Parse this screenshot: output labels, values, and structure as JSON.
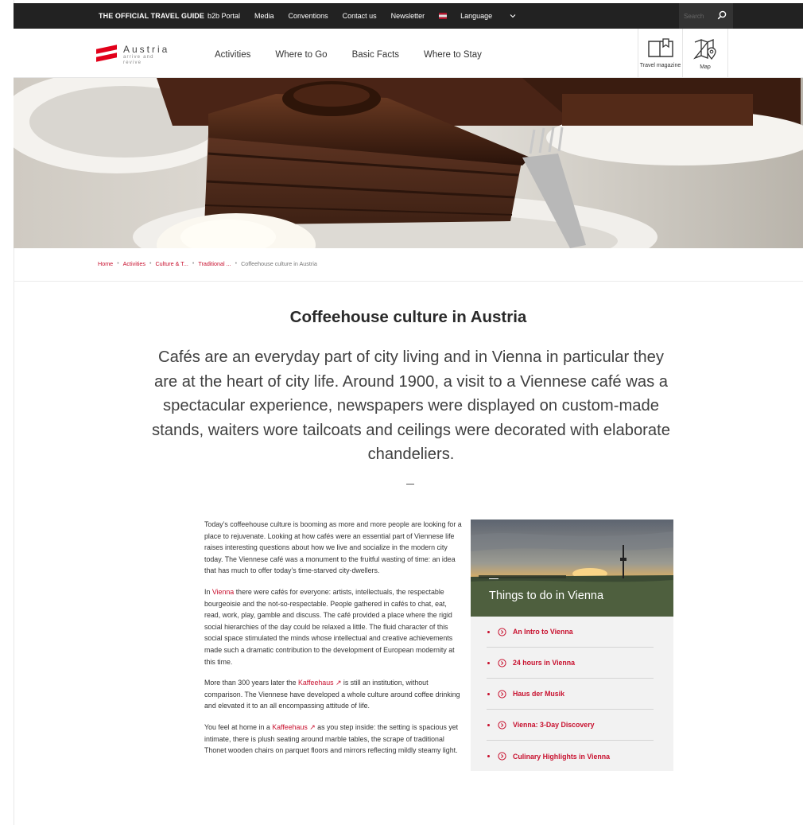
{
  "topbar": {
    "official": "THE OFFICIAL TRAVEL GUIDE",
    "links": [
      "b2b Portal",
      "Media",
      "Conventions",
      "Contact us",
      "Newsletter"
    ],
    "language": "Language",
    "search_placeholder": "Search"
  },
  "header": {
    "logo": {
      "name": "Austria",
      "tagline": "arrive and revive"
    },
    "nav": [
      "Activities",
      "Where to Go",
      "Basic Facts",
      "Where to Stay"
    ],
    "travel_magazine": "Travel magazine",
    "map": "Map"
  },
  "breadcrumb": [
    "Home",
    "Activities",
    "Culture & T...",
    "Traditional ...",
    "Coffeehouse culture in Austria"
  ],
  "article": {
    "title": "Coffeehouse culture in Austria",
    "lead": "Cafés are an everyday part of city living and in Vienna in particular they are at the heart of city life. Around 1900, a visit to a Viennese café was a spectacular experience, newspapers were displayed on custom-made stands, waiters wore tailcoats and ceilings were decorated with elaborate chandeliers.",
    "p1": "Today’s coffeehouse culture is booming as more and more people are looking for a place to rejuvenate. Looking at how cafés were an essential part of Viennese life raises interesting questions about how we live and socialize in the modern city today. The Viennese café was a monument to the fruitful wasting of time: an idea that has much to offer today’s time-starved city-dwellers.",
    "p2_pre": "In ",
    "p2_link": "Vienna",
    "p2_post": " there were cafés for everyone: artists, intellectuals, the respectable bourgeoisie and the not-so-respectable. People gathered in cafés to chat, eat, read, work, play, gamble and discuss. The café provided a place where the rigid social hierarchies of the day could be relaxed a little. The fluid character of this social space stimulated the minds whose intellectual and creative achievements made such a dramatic contribution to the development of European modernity at this time.",
    "p3_pre": "More than 300 years later the ",
    "p3_link": "Kaffeehaus ↗",
    "p3_post": " is still an institution, without comparison. The Viennese have developed a whole culture around coffee drinking and elevated it to an all encompassing attitude of life.",
    "p4_pre": "You feel at home in a ",
    "p4_link": "Kaffeehaus ↗",
    "p4_post": " as you step inside: the setting is spacious yet intimate, there is plush seating around marble tables, the scrape of traditional Thonet wooden chairs on parquet floors and mirrors reflecting mildly steamy light."
  },
  "sidebox": {
    "title": "Things to do in Vienna",
    "items": [
      "An Intro to Vienna",
      "24 hours in Vienna",
      "Haus der Musik",
      "Vienna: 3-Day Discovery",
      "Culinary Highlights in Vienna"
    ]
  },
  "colors": {
    "accent": "#c8102e",
    "topbar": "#222222"
  },
  "icons": [
    "search-icon",
    "chevron-down-icon",
    "flag-icon",
    "book-icon",
    "map-pin-icon",
    "chevron-circle-icon"
  ]
}
